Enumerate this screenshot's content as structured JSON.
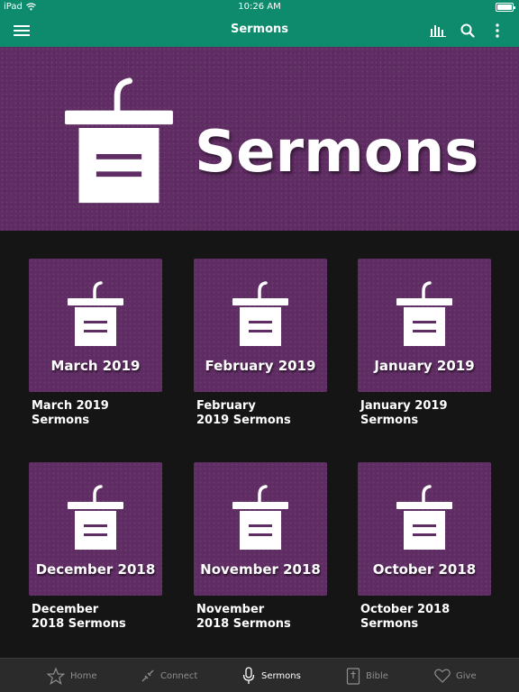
{
  "status": {
    "device": "iPad",
    "time": "10:26 AM"
  },
  "app_bar": {
    "title": "Sermons"
  },
  "banner": {
    "title": "Sermons"
  },
  "cards": [
    {
      "tile": "March 2019",
      "caption": "March 2019 Sermons"
    },
    {
      "tile": "February 2019",
      "caption": "February\n2019 Sermons"
    },
    {
      "tile": "January 2019",
      "caption": "January 2019\nSermons"
    },
    {
      "tile": "December 2018",
      "caption": "December\n2018 Sermons"
    },
    {
      "tile": "November 2018",
      "caption": "November\n2018 Sermons"
    },
    {
      "tile": "October 2018",
      "caption": "October 2018\nSermons"
    }
  ],
  "tabs": [
    {
      "label": "Home",
      "icon": "star-icon"
    },
    {
      "label": "Connect",
      "icon": "connect-icon"
    },
    {
      "label": "Sermons",
      "icon": "microphone-icon",
      "active": true
    },
    {
      "label": "Bible",
      "icon": "bible-icon"
    },
    {
      "label": "Give",
      "icon": "heart-icon"
    }
  ],
  "colors": {
    "header": "#0d8b6c",
    "purple": "#5f2c63",
    "background": "#151515",
    "tab_bar": "#2b2b2b"
  }
}
